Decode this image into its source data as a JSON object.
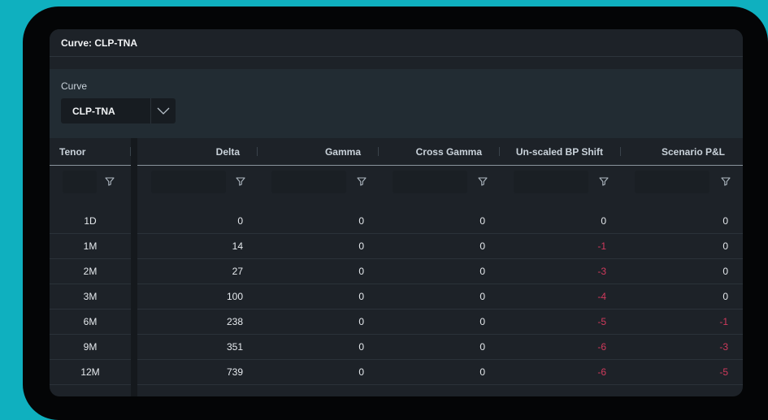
{
  "window": {
    "title": "Curve: CLP-TNA"
  },
  "curve_panel": {
    "label": "Curve",
    "selected": "CLP-TNA"
  },
  "table": {
    "columns": [
      "Tenor",
      "Delta",
      "Gamma",
      "Cross Gamma",
      "Un-scaled BP Shift",
      "Scenario P&L"
    ],
    "rows": [
      {
        "tenor": "1D",
        "delta": "0",
        "gamma": "0",
        "cross": "0",
        "shift": "0",
        "pnl": "0"
      },
      {
        "tenor": "1M",
        "delta": "14",
        "gamma": "0",
        "cross": "0",
        "shift": "-1",
        "pnl": "0"
      },
      {
        "tenor": "2M",
        "delta": "27",
        "gamma": "0",
        "cross": "0",
        "shift": "-3",
        "pnl": "0"
      },
      {
        "tenor": "3M",
        "delta": "100",
        "gamma": "0",
        "cross": "0",
        "shift": "-4",
        "pnl": "0"
      },
      {
        "tenor": "6M",
        "delta": "238",
        "gamma": "0",
        "cross": "0",
        "shift": "-5",
        "pnl": "-1"
      },
      {
        "tenor": "9M",
        "delta": "351",
        "gamma": "0",
        "cross": "0",
        "shift": "-6",
        "pnl": "-3"
      },
      {
        "tenor": "12M",
        "delta": "739",
        "gamma": "0",
        "cross": "0",
        "shift": "-6",
        "pnl": "-5"
      }
    ]
  },
  "colors": {
    "negative": "#d03a5c",
    "background": "#1d2228",
    "frame": "#040506",
    "page": "#0fb0bf"
  }
}
